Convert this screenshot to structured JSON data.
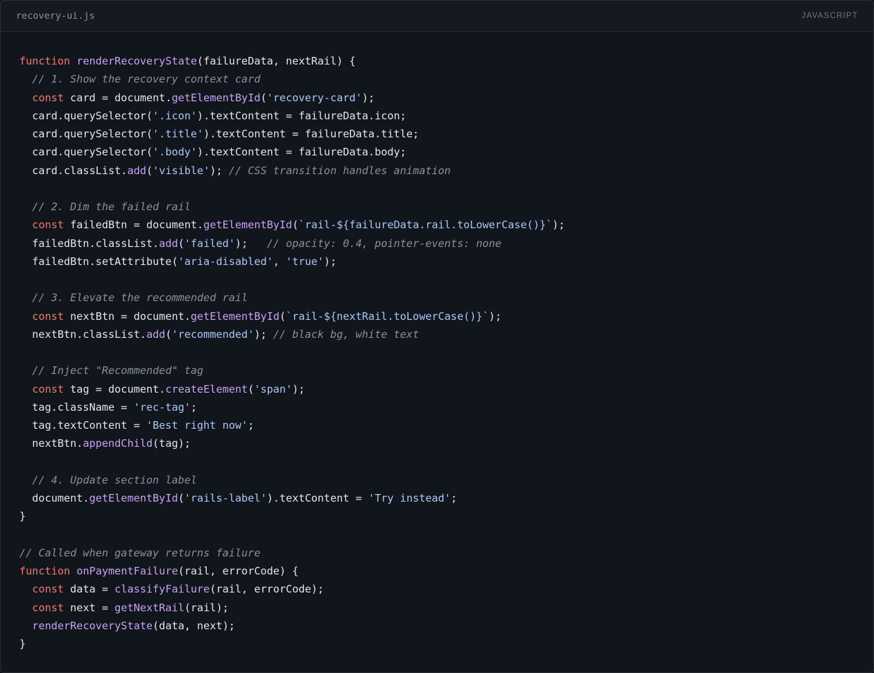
{
  "editor": {
    "filename": "recovery-ui.js",
    "language": "JAVASCRIPT"
  },
  "colors": {
    "background": "#11151c",
    "keyword": "#f07b6c",
    "function": "#c7a3f0",
    "string": "#a9c8f5",
    "comment": "#8a919b",
    "text": "#e6e6e6"
  },
  "code": {
    "lines": [
      [
        [
          "kw",
          "function"
        ],
        [
          "pl",
          " "
        ],
        [
          "fn",
          "renderRecoveryState"
        ],
        [
          "pl",
          "(failureData, nextRail) {"
        ]
      ],
      [
        [
          "pl",
          "  "
        ],
        [
          "cm",
          "// 1. Show the recovery context card"
        ]
      ],
      [
        [
          "pl",
          "  "
        ],
        [
          "kw",
          "const"
        ],
        [
          "pl",
          " card = document."
        ],
        [
          "fn",
          "getElementById"
        ],
        [
          "pl",
          "("
        ],
        [
          "str",
          "'recovery-card'"
        ],
        [
          "pl",
          ");"
        ]
      ],
      [
        [
          "pl",
          "  card.querySelector("
        ],
        [
          "str",
          "'.icon'"
        ],
        [
          "pl",
          ").textContent = failureData.icon;"
        ]
      ],
      [
        [
          "pl",
          "  card.querySelector("
        ],
        [
          "str",
          "'.title'"
        ],
        [
          "pl",
          ").textContent = failureData.title;"
        ]
      ],
      [
        [
          "pl",
          "  card.querySelector("
        ],
        [
          "str",
          "'.body'"
        ],
        [
          "pl",
          ").textContent = failureData.body;"
        ]
      ],
      [
        [
          "pl",
          "  card.classList."
        ],
        [
          "fn",
          "add"
        ],
        [
          "pl",
          "("
        ],
        [
          "str",
          "'visible'"
        ],
        [
          "pl",
          "); "
        ],
        [
          "cm",
          "// CSS transition handles animation"
        ]
      ],
      [],
      [
        [
          "pl",
          "  "
        ],
        [
          "cm",
          "// 2. Dim the failed rail"
        ]
      ],
      [
        [
          "pl",
          "  "
        ],
        [
          "kw",
          "const"
        ],
        [
          "pl",
          " failedBtn = document."
        ],
        [
          "fn",
          "getElementById"
        ],
        [
          "pl",
          "("
        ],
        [
          "str",
          "`rail-${failureData.rail.toLowerCase()}`"
        ],
        [
          "pl",
          ");"
        ]
      ],
      [
        [
          "pl",
          "  failedBtn.classList."
        ],
        [
          "fn",
          "add"
        ],
        [
          "pl",
          "("
        ],
        [
          "str",
          "'failed'"
        ],
        [
          "pl",
          ");   "
        ],
        [
          "cm",
          "// opacity: 0.4, pointer-events: none"
        ]
      ],
      [
        [
          "pl",
          "  failedBtn.setAttribute("
        ],
        [
          "str",
          "'aria-disabled'"
        ],
        [
          "pl",
          ", "
        ],
        [
          "str",
          "'true'"
        ],
        [
          "pl",
          ");"
        ]
      ],
      [],
      [
        [
          "pl",
          "  "
        ],
        [
          "cm",
          "// 3. Elevate the recommended rail"
        ]
      ],
      [
        [
          "pl",
          "  "
        ],
        [
          "kw",
          "const"
        ],
        [
          "pl",
          " nextBtn = document."
        ],
        [
          "fn",
          "getElementById"
        ],
        [
          "pl",
          "("
        ],
        [
          "str",
          "`rail-${nextRail.toLowerCase()}`"
        ],
        [
          "pl",
          ");"
        ]
      ],
      [
        [
          "pl",
          "  nextBtn.classList."
        ],
        [
          "fn",
          "add"
        ],
        [
          "pl",
          "("
        ],
        [
          "str",
          "'recommended'"
        ],
        [
          "pl",
          "); "
        ],
        [
          "cm",
          "// black bg, white text"
        ]
      ],
      [],
      [
        [
          "pl",
          "  "
        ],
        [
          "cm",
          "// Inject \"Recommended\" tag"
        ]
      ],
      [
        [
          "pl",
          "  "
        ],
        [
          "kw",
          "const"
        ],
        [
          "pl",
          " tag = document."
        ],
        [
          "fn",
          "createElement"
        ],
        [
          "pl",
          "("
        ],
        [
          "str",
          "'span'"
        ],
        [
          "pl",
          ");"
        ]
      ],
      [
        [
          "pl",
          "  tag.className = "
        ],
        [
          "str",
          "'rec-tag'"
        ],
        [
          "pl",
          ";"
        ]
      ],
      [
        [
          "pl",
          "  tag.textContent = "
        ],
        [
          "str",
          "'Best right now'"
        ],
        [
          "pl",
          ";"
        ]
      ],
      [
        [
          "pl",
          "  nextBtn."
        ],
        [
          "fn",
          "appendChild"
        ],
        [
          "pl",
          "(tag);"
        ]
      ],
      [],
      [
        [
          "pl",
          "  "
        ],
        [
          "cm",
          "// 4. Update section label"
        ]
      ],
      [
        [
          "pl",
          "  document."
        ],
        [
          "fn",
          "getElementById"
        ],
        [
          "pl",
          "("
        ],
        [
          "str",
          "'rails-label'"
        ],
        [
          "pl",
          ").textContent = "
        ],
        [
          "str",
          "'Try instead'"
        ],
        [
          "pl",
          ";"
        ]
      ],
      [
        [
          "pl",
          "}"
        ]
      ],
      [],
      [
        [
          "cm",
          "// Called when gateway returns failure"
        ]
      ],
      [
        [
          "kw",
          "function"
        ],
        [
          "pl",
          " "
        ],
        [
          "fn",
          "onPaymentFailure"
        ],
        [
          "pl",
          "(rail, errorCode) {"
        ]
      ],
      [
        [
          "pl",
          "  "
        ],
        [
          "kw",
          "const"
        ],
        [
          "pl",
          " data = "
        ],
        [
          "fn",
          "classifyFailure"
        ],
        [
          "pl",
          "(rail, errorCode);"
        ]
      ],
      [
        [
          "pl",
          "  "
        ],
        [
          "kw",
          "const"
        ],
        [
          "pl",
          " next = "
        ],
        [
          "fn",
          "getNextRail"
        ],
        [
          "pl",
          "(rail);"
        ]
      ],
      [
        [
          "pl",
          "  "
        ],
        [
          "fn",
          "renderRecoveryState"
        ],
        [
          "pl",
          "(data, next);"
        ]
      ],
      [
        [
          "pl",
          "}"
        ]
      ]
    ]
  }
}
